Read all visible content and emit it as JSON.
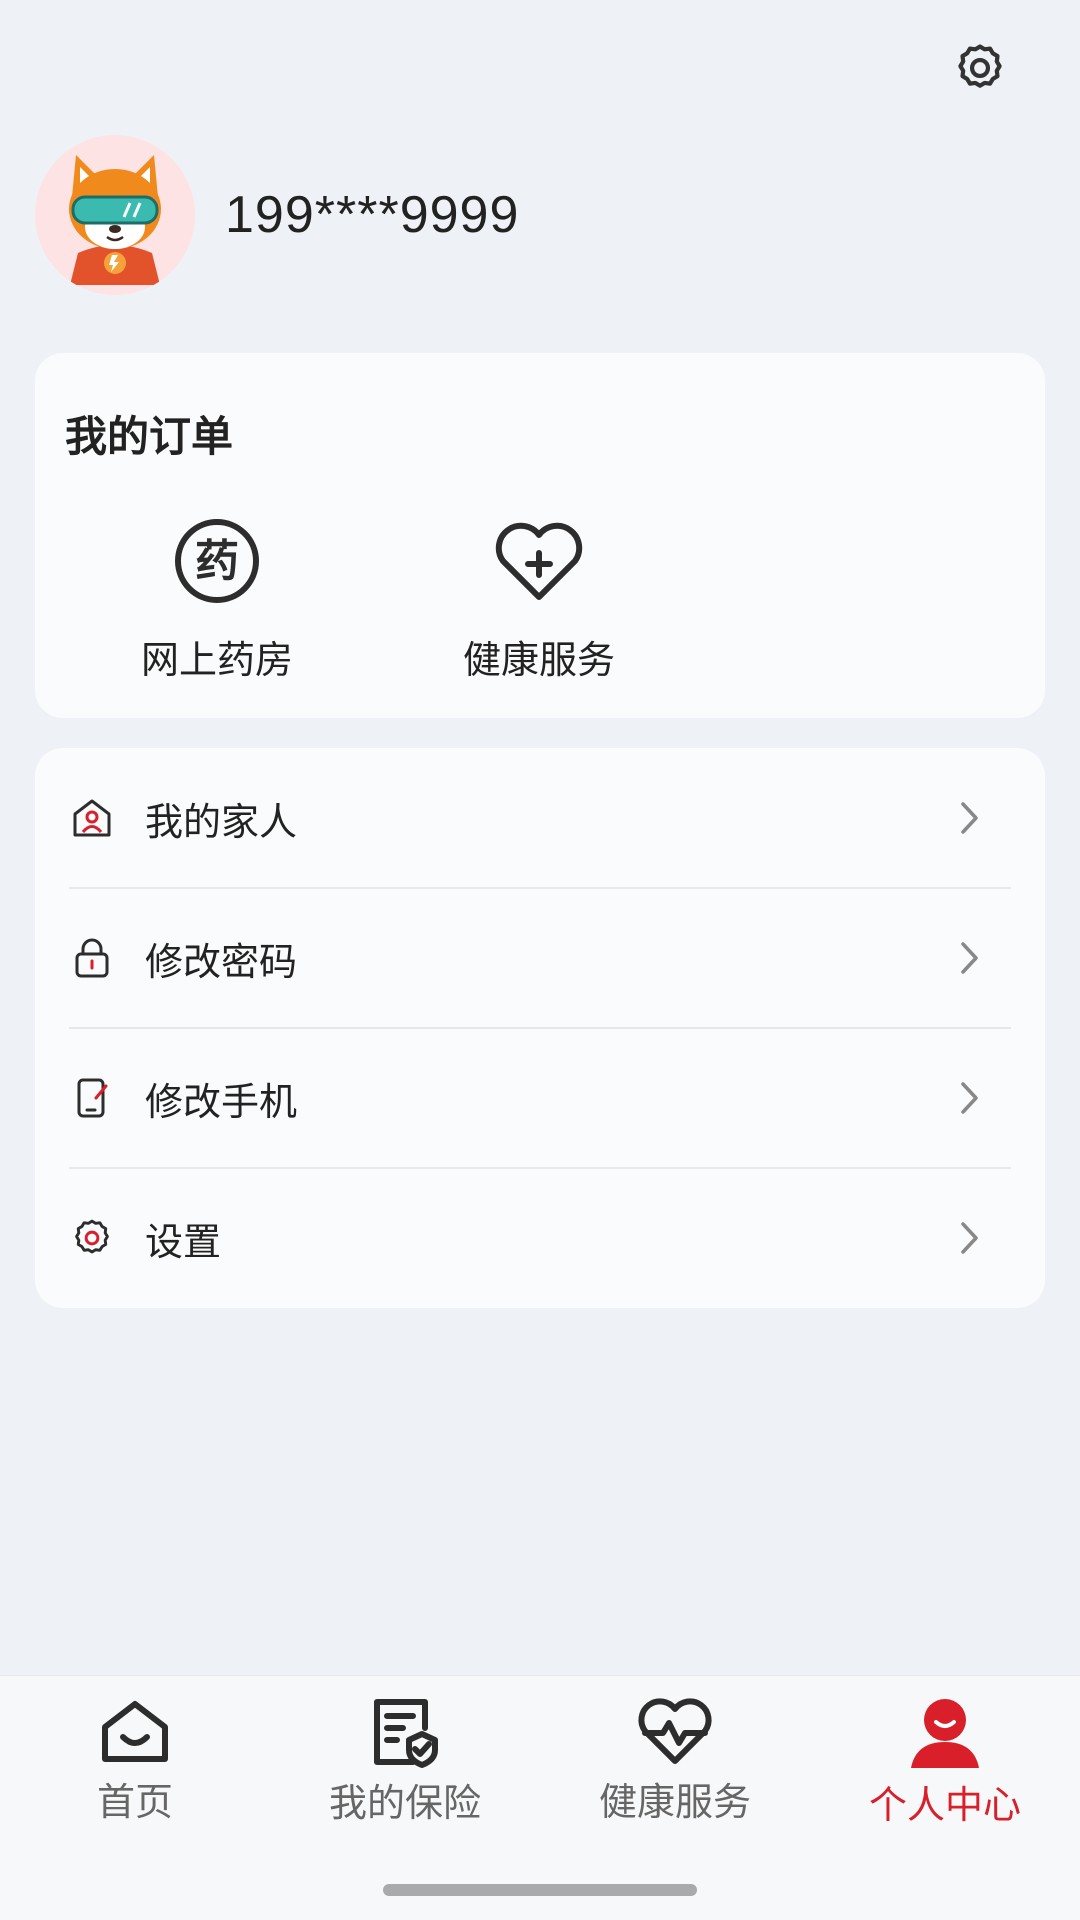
{
  "header": {
    "settings_icon": "gear-icon"
  },
  "profile": {
    "avatar_icon": "shiba-dog-avatar",
    "phone": "199****9999"
  },
  "orders": {
    "title": "我的订单",
    "items": [
      {
        "label": "网上药房",
        "icon": "pharmacy-icon",
        "icon_glyph": "药"
      },
      {
        "label": "健康服务",
        "icon": "heart-plus-icon"
      }
    ]
  },
  "menu": {
    "items": [
      {
        "label": "我的家人",
        "icon": "family-icon"
      },
      {
        "label": "修改密码",
        "icon": "lock-icon"
      },
      {
        "label": "修改手机",
        "icon": "phone-edit-icon"
      },
      {
        "label": "设置",
        "icon": "settings-icon"
      }
    ]
  },
  "tabbar": {
    "tabs": [
      {
        "label": "首页",
        "icon": "home-icon"
      },
      {
        "label": "我的保险",
        "icon": "insurance-doc-icon"
      },
      {
        "label": "健康服务",
        "icon": "heartbeat-icon"
      },
      {
        "label": "个人中心",
        "icon": "person-icon",
        "active": true
      }
    ]
  },
  "colors": {
    "accent": "#d81f2a",
    "background": "#eef2f6",
    "card": "#fafbfc"
  }
}
